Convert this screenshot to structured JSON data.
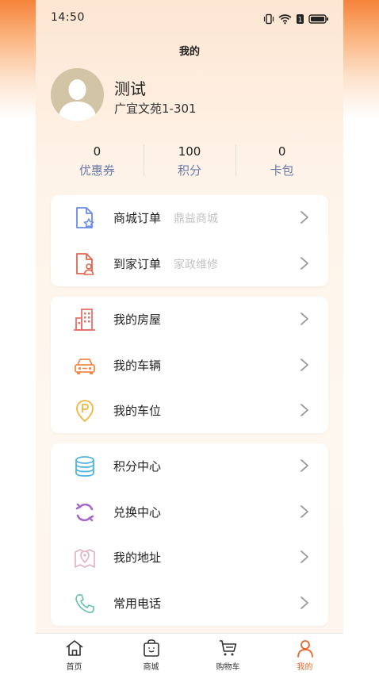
{
  "status_bar": {
    "time": "14:50"
  },
  "page": {
    "title": "我的"
  },
  "user": {
    "name": "测试",
    "address": "广宜文苑1-301"
  },
  "stats": [
    {
      "value": "0",
      "label": "优惠券"
    },
    {
      "value": "100",
      "label": "积分"
    },
    {
      "value": "0",
      "label": "卡包"
    }
  ],
  "orders": {
    "mall": {
      "label": "商城订单",
      "sub": "鼎益商城",
      "icon": "document-star-icon"
    },
    "home": {
      "label": "到家订单",
      "sub": "家政维修",
      "icon": "document-person-icon"
    }
  },
  "property": {
    "house": {
      "label": "我的房屋",
      "icon": "building-icon"
    },
    "vehicle": {
      "label": "我的车辆",
      "icon": "car-icon"
    },
    "parking": {
      "label": "我的车位",
      "icon": "parking-icon"
    }
  },
  "services": {
    "points": {
      "label": "积分中心",
      "icon": "coins-stack-icon"
    },
    "exchange": {
      "label": "兑换中心",
      "icon": "exchange-arrows-icon"
    },
    "address": {
      "label": "我的地址",
      "icon": "map-pin-icon"
    },
    "phone": {
      "label": "常用电话",
      "icon": "phone-icon"
    }
  },
  "tabbar": {
    "home": "首页",
    "mall": "商城",
    "cart": "购物车",
    "mine": "我的"
  },
  "colors": {
    "accent": "#e8652b",
    "stat_label": "#6a7aa8",
    "subtext": "#c3c3c3"
  }
}
